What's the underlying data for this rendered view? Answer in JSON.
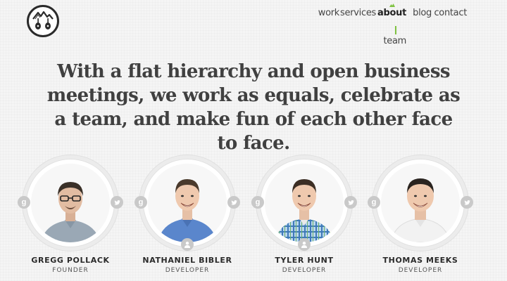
{
  "nav": {
    "items": [
      {
        "label": "work",
        "active": false
      },
      {
        "label": "services",
        "active": false
      },
      {
        "label": "about",
        "active": true
      },
      {
        "label": "blog",
        "active": false
      },
      {
        "label": "contact",
        "active": false
      }
    ],
    "sub_item": "team"
  },
  "headline": "With a flat hierarchy and open business meetings, we work as equals, celebrate as a team, and make fun of each other face to face.",
  "team": [
    {
      "name": "GREGG POLLACK",
      "role": "FOUNDER",
      "gplus_glyph": "g",
      "has_user_badge": false
    },
    {
      "name": "NATHANIEL BIBLER",
      "role": "DEVELOPER",
      "gplus_glyph": "g",
      "has_user_badge": true
    },
    {
      "name": "TYLER HUNT",
      "role": "DEVELOPER",
      "gplus_glyph": "g",
      "has_user_badge": true
    },
    {
      "name": "THOMAS MEEKS",
      "role": "DEVELOPER",
      "gplus_glyph": "g",
      "has_user_badge": false
    }
  ],
  "colors": {
    "accent": "#7fc241",
    "background": "#f5f5f5",
    "icon_gray": "#c9c9c9",
    "text_dark": "#2a2a2a"
  },
  "icons": {
    "logo": "mountain-guitars-logo",
    "gplus": "google-plus-icon",
    "twitter": "twitter-icon",
    "user": "user-icon"
  }
}
